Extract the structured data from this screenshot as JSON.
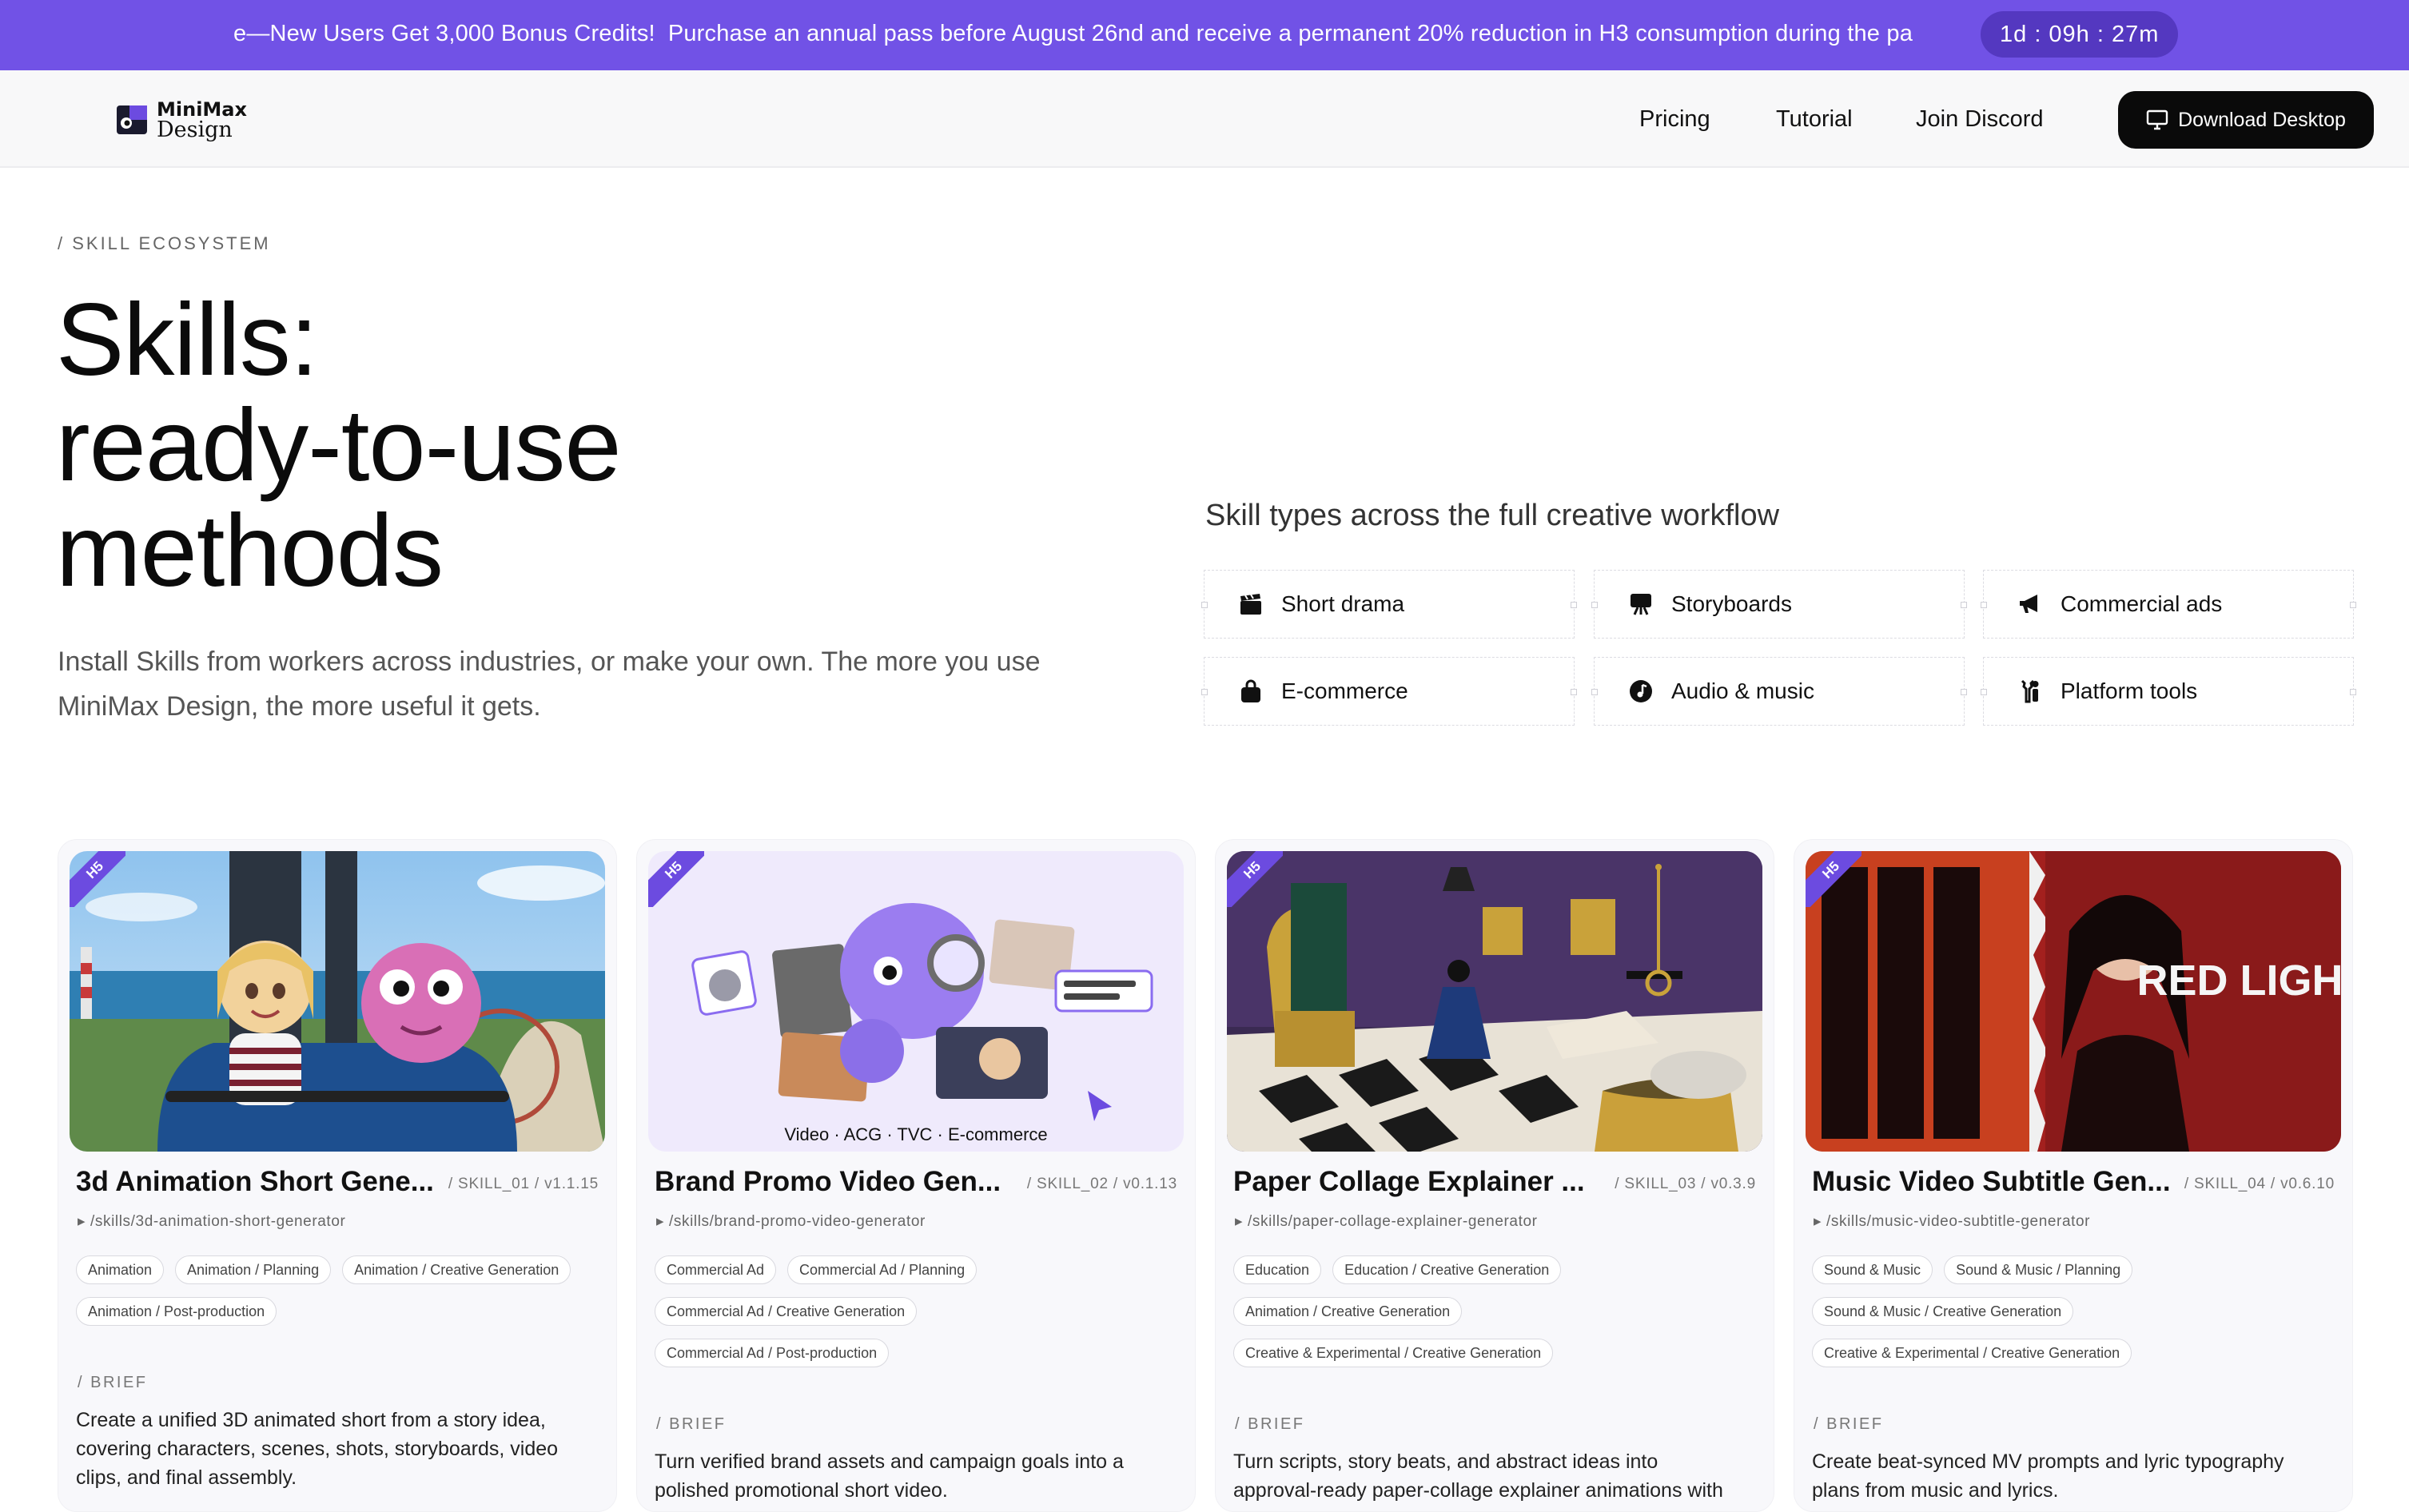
{
  "banner": {
    "text": "e—New Users Get 3,000 Bonus Credits!",
    "text2": "Purchase an annual pass before August 26nd and receive a permanent 20% reduction in H3 consumption during the pa",
    "countdown": "1d : 09h : 27m"
  },
  "header": {
    "logo_line1": "MiniMax",
    "logo_line2": "Design",
    "nav": [
      "Pricing",
      "Tutorial",
      "Join Discord"
    ],
    "download_label": "Download Desktop"
  },
  "hero": {
    "eyebrow": "/ SKILL ECOSYSTEM",
    "title_lines": [
      "Skills:",
      "ready-to-use",
      "methods"
    ],
    "lead": "Install Skills from workers across industries, or make your own. The more you use MiniMax Design, the more useful it gets.",
    "types_title": "Skill types across the full creative workflow",
    "types": [
      {
        "label": "Short drama",
        "icon": "clapperboard-icon"
      },
      {
        "label": "Storyboards",
        "icon": "easel-icon"
      },
      {
        "label": "Commercial ads",
        "icon": "megaphone-icon"
      },
      {
        "label": "E-commerce",
        "icon": "shopping-bag-icon"
      },
      {
        "label": "Audio & music",
        "icon": "music-note-icon"
      },
      {
        "label": "Platform tools",
        "icon": "tools-icon"
      }
    ]
  },
  "ribbon_label": "H5",
  "brief_label": "/ BRIEF",
  "thumb2_caption": "Video · ACG · TVC · E-commerce",
  "thumb4_text": "RED LIGHT",
  "cards": [
    {
      "title": "3d Animation Short Gene...",
      "meta": "/ SKILL_01 / v1.1.15",
      "path": "▸ /skills/3d-animation-short-generator",
      "tags": [
        "Animation",
        "Animation / Planning",
        "Animation / Creative Generation",
        "Animation / Post-production"
      ],
      "brief": "Create a unified 3D animated short from a story idea, covering characters, scenes, shots, storyboards, video clips, and final assembly."
    },
    {
      "title": "Brand Promo Video Gen...",
      "meta": "/ SKILL_02 / v0.1.13",
      "path": "▸ /skills/brand-promo-video-generator",
      "tags": [
        "Commercial Ad",
        "Commercial Ad / Planning",
        "Commercial Ad / Creative Generation",
        "Commercial Ad / Post-production"
      ],
      "brief": "Turn verified brand assets and campaign goals into a polished promotional short video."
    },
    {
      "title": "Paper Collage Explainer ...",
      "meta": "/ SKILL_03 / v0.3.9",
      "path": "▸ /skills/paper-collage-explainer-generator",
      "tags": [
        "Education",
        "Education / Creative Generation",
        "Animation / Creative Generation",
        "Creative & Experimental / Creative Generation"
      ],
      "brief": "Turn scripts, story beats, and abstract ideas into approval-ready paper-collage explainer animations with"
    },
    {
      "title": "Music Video Subtitle Gen...",
      "meta": "/ SKILL_04 / v0.6.10",
      "path": "▸ /skills/music-video-subtitle-generator",
      "tags": [
        "Sound & Music",
        "Sound & Music / Planning",
        "Sound & Music / Creative Generation",
        "Creative & Experimental / Creative Generation"
      ],
      "brief": "Create beat-synced MV prompts and lyric typography plans from music and lyrics."
    }
  ]
}
